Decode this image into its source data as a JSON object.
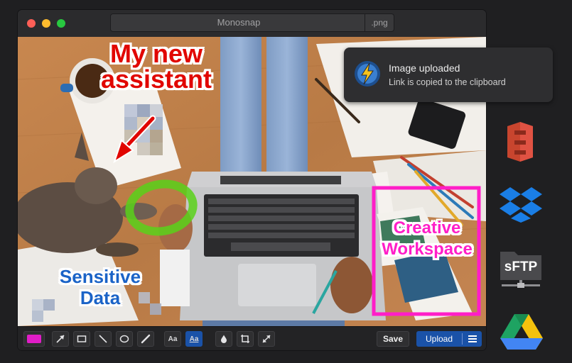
{
  "window": {
    "title": "Monosnap",
    "extension": ".png"
  },
  "annotations": {
    "red_text": [
      "My new",
      "assistant"
    ],
    "blue_text": [
      "Sensitive",
      "Data"
    ],
    "pink_text": [
      "Creative",
      "Workspace"
    ],
    "colors": {
      "red": "#e10600",
      "blue": "#1a63c7",
      "pink": "#ff1ec8",
      "green": "#59d11a"
    }
  },
  "toolbar": {
    "color_swatch": "#e11dc8",
    "tools": [
      "arrow-icon",
      "rectangle-icon",
      "line-icon",
      "ellipse-icon",
      "pen-icon",
      "text-icon",
      "text-outline-icon",
      "blur-icon",
      "crop-icon",
      "resize-icon"
    ],
    "text_tool_label": "Aa",
    "save_label": "Save",
    "upload_label": "Upload"
  },
  "notification": {
    "title": "Image uploaded",
    "subtitle": "Link is copied to the clipboard"
  },
  "services": {
    "sftp_label": "sFTP",
    "items": [
      "amazon-s3-icon",
      "dropbox-icon",
      "sftp-icon",
      "google-drive-icon"
    ]
  }
}
